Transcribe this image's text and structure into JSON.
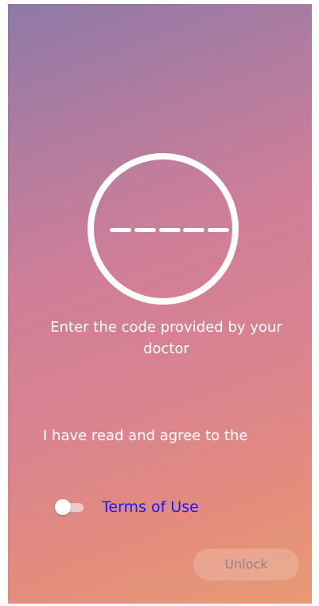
{
  "screen": {
    "code_entry": {
      "slots": 5,
      "instruction": "Enter the code provided by your doctor"
    },
    "agreement": {
      "text": "I have read and agree to the",
      "terms_link": "Terms of Use",
      "toggle_checked": false
    },
    "unlock_button": {
      "label": "Unlock",
      "enabled": false
    }
  },
  "colors": {
    "gradient_top": "#8e79a8",
    "gradient_mid": "#d07e98",
    "gradient_bottom": "#e79a74",
    "link": "#1a1aff",
    "text": "#ffffff"
  }
}
